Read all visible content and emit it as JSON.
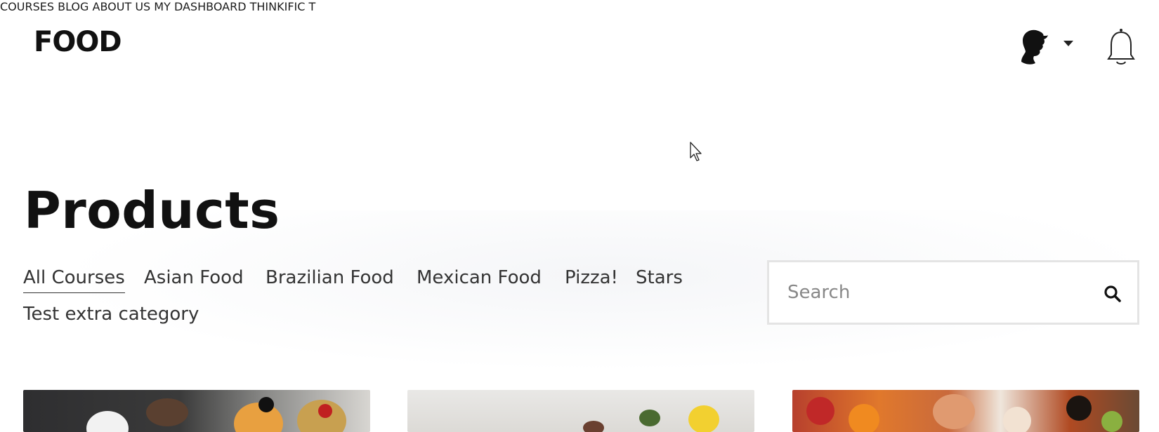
{
  "header": {
    "logo_text": "FOOD",
    "nav": [
      {
        "label": "COURSES"
      },
      {
        "label": "BLOG"
      },
      {
        "label": "ABOUT US"
      },
      {
        "label": "MY DASHBOARD"
      },
      {
        "label": "THINKIFIC T"
      }
    ]
  },
  "main": {
    "title": "Products",
    "categories": [
      {
        "label": "All Courses",
        "active": true
      },
      {
        "label": "Asian Food"
      },
      {
        "label": "Brazilian Food"
      },
      {
        "label": "Mexican Food"
      },
      {
        "label": "Pizza!"
      },
      {
        "label": "Stars"
      },
      {
        "label": "Test extra category"
      }
    ],
    "search": {
      "placeholder": "Search",
      "value": ""
    }
  },
  "icons": {
    "avatar": "avatar-silhouette-icon",
    "dropdown": "chevron-down-icon",
    "notifications": "bell-icon",
    "search": "search-icon",
    "cursor": "mouse-pointer-icon"
  }
}
